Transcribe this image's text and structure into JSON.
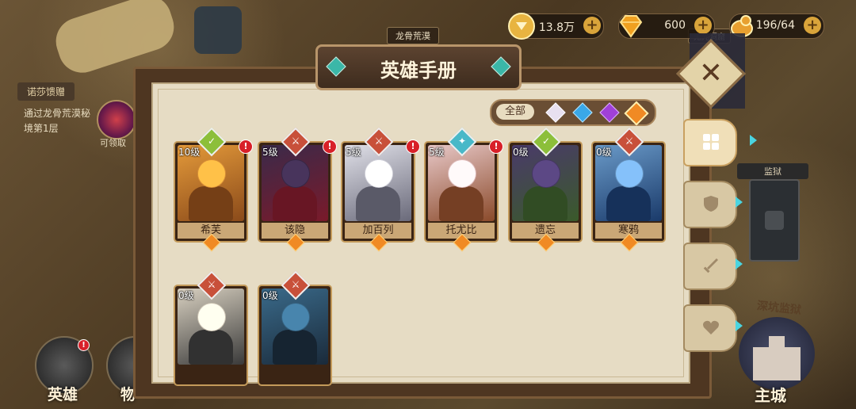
{
  "resources": {
    "gold": {
      "value": "13.8万",
      "icon": "gold-coin-icon",
      "color": "#e0a93a"
    },
    "diamond": {
      "value": "600",
      "icon": "diamond-icon",
      "color": "#f0a020"
    },
    "stamina": {
      "value": "196/64",
      "icon": "stamina-bird-icon",
      "color": "#e8a030"
    }
  },
  "map": {
    "location_label": "龙骨荒漠",
    "top_right_label": "无光洞窟",
    "prison_label": "监狱",
    "deep_prison_label": "深坑监狱"
  },
  "quest": {
    "title": "诺莎馈赠",
    "description": "通过龙骨荒漠秘境第1层",
    "claim": "可领取"
  },
  "bottom_nav": {
    "hero": "英雄",
    "second": "物",
    "main_city": "主城"
  },
  "panel": {
    "title": "英雄手册",
    "filter_all": "全部",
    "filters": [
      {
        "name": "white",
        "color": "#e8e0f0"
      },
      {
        "name": "blue",
        "color": "#3aa8e8"
      },
      {
        "name": "purple",
        "color": "#a040d8"
      },
      {
        "name": "orange",
        "color": "#f08a24"
      }
    ],
    "side_tabs": [
      "grid",
      "shield",
      "sword",
      "heart"
    ]
  },
  "heroes": [
    {
      "name": "希芙",
      "level": "10级",
      "role_color": "#8cbf3a",
      "role_mark": "✓",
      "alert": true,
      "portrait": [
        "#e49a3a",
        "#8a4a1a"
      ]
    },
    {
      "name": "该隐",
      "level": "5级",
      "role_color": "#c8503a",
      "role_mark": "⚔",
      "alert": true,
      "portrait": [
        "#3a2a4a",
        "#7a1a2a"
      ]
    },
    {
      "name": "加百列",
      "level": "5级",
      "role_color": "#c8503a",
      "role_mark": "⚔",
      "alert": true,
      "portrait": [
        "#e0e0e8",
        "#6a6a7a"
      ]
    },
    {
      "name": "托尤比",
      "level": "5级",
      "role_color": "#48b8c8",
      "role_mark": "✦",
      "alert": true,
      "portrait": [
        "#e8c8c8",
        "#8a4a2a"
      ]
    },
    {
      "name": "遗忘",
      "level": "0级",
      "role_color": "#8cbf3a",
      "role_mark": "✓",
      "alert": false,
      "portrait": [
        "#4a3a6a",
        "#3a5a2a"
      ]
    },
    {
      "name": "寒鸦",
      "level": "0级",
      "role_color": "#c8503a",
      "role_mark": "⚔",
      "alert": false,
      "portrait": [
        "#6a9ac8",
        "#1a3a6a"
      ]
    },
    {
      "name": "",
      "level": "0级",
      "role_color": "#c8503a",
      "role_mark": "⚔",
      "alert": false,
      "portrait": [
        "#d8d0c0",
        "#3a3a3a"
      ]
    },
    {
      "name": "",
      "level": "0级",
      "role_color": "#c8503a",
      "role_mark": "⚔",
      "alert": false,
      "portrait": [
        "#3a6a8a",
        "#1a2a3a"
      ]
    }
  ]
}
